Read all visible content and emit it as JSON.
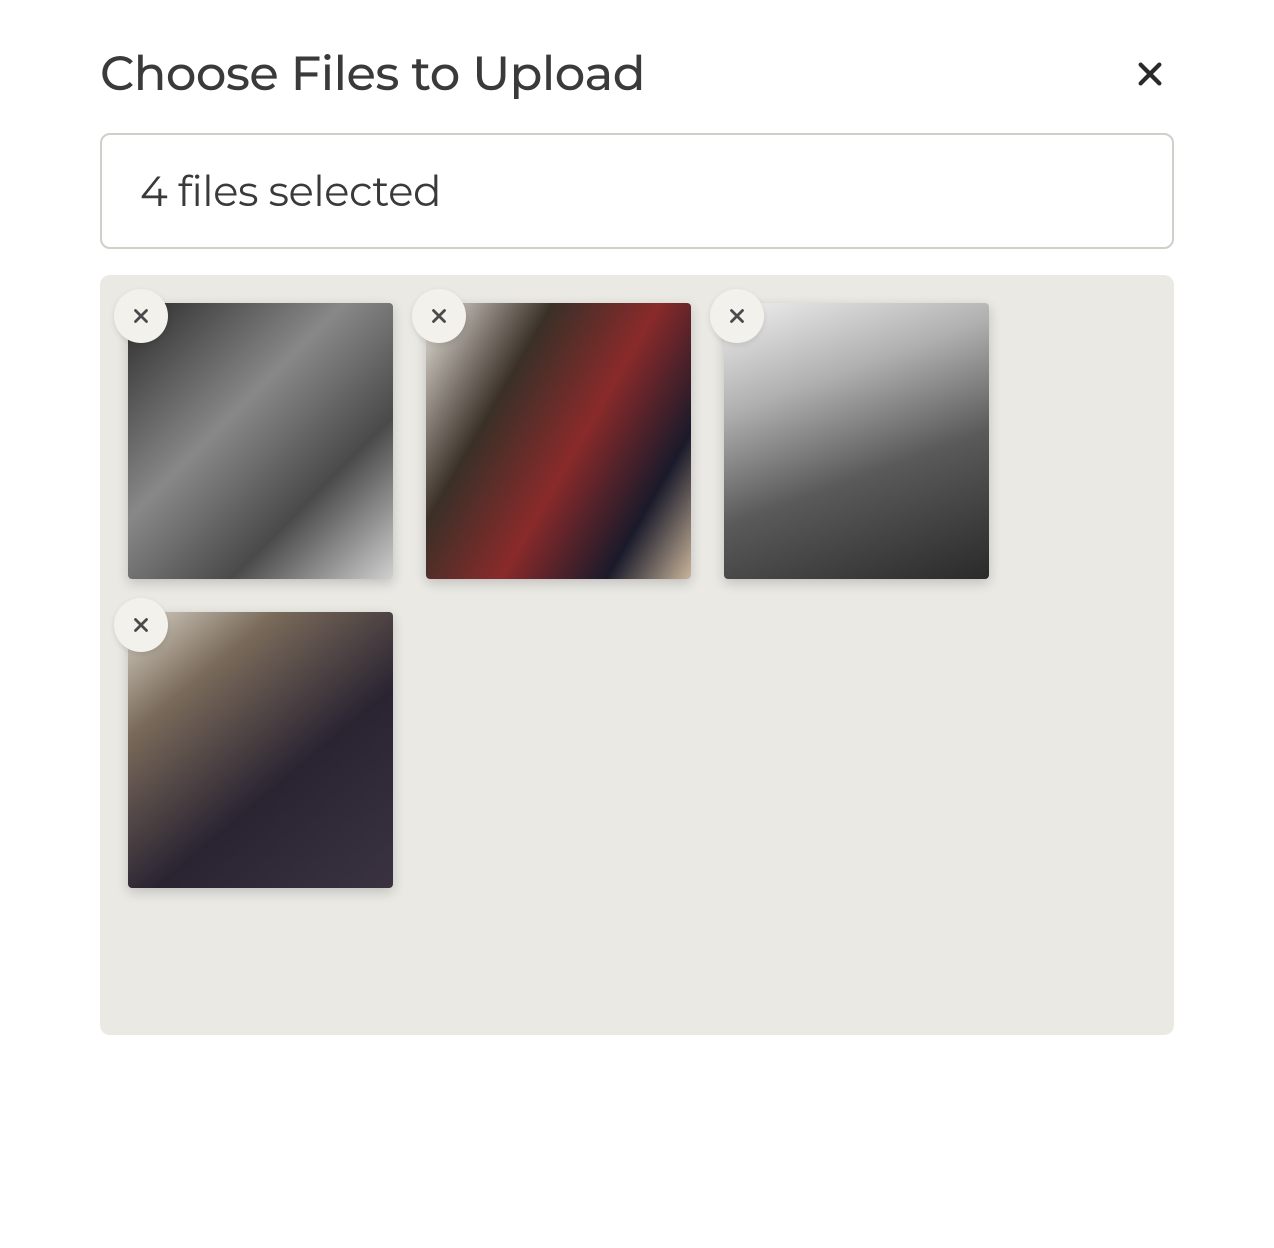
{
  "dialog": {
    "title": "Choose Files to Upload",
    "close_label": "Close"
  },
  "file_input": {
    "status_text": "4 files selected",
    "file_count": 4
  },
  "thumbnails": [
    {
      "remove_label": "Remove",
      "alt": "thumbnail-1"
    },
    {
      "remove_label": "Remove",
      "alt": "thumbnail-2"
    },
    {
      "remove_label": "Remove",
      "alt": "thumbnail-3"
    },
    {
      "remove_label": "Remove",
      "alt": "thumbnail-4"
    }
  ]
}
